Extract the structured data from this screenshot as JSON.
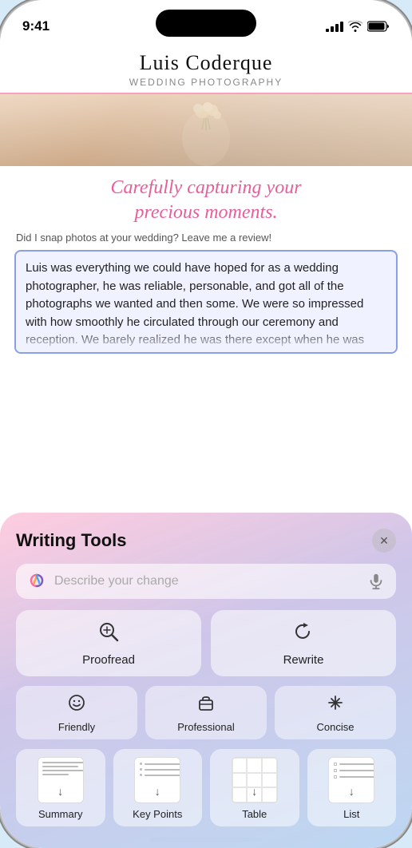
{
  "status_bar": {
    "time": "9:41",
    "signal_bars": 4,
    "wifi": true,
    "battery": "full"
  },
  "site": {
    "title": "Luis Coderque",
    "subtitle": "Wedding Photography",
    "tagline": "Carefully capturing your\nprecious moments.",
    "review_prompt": "Did I snap photos at your wedding? Leave me a review!",
    "review_text": "Luis was everything we could have hoped for as a wedding photographer, he was reliable, personable, and got all of the photographs we wanted and then some. We were so impressed with how smoothly he circulated through our ceremony and reception. We barely realized he was there except when he was very"
  },
  "writing_tools": {
    "title": "Writing Tools",
    "close_label": "✕",
    "search_placeholder": "Describe your change",
    "tools_large": [
      {
        "id": "proofread",
        "label": "Proofread",
        "icon": "🔍"
      },
      {
        "id": "rewrite",
        "label": "Rewrite",
        "icon": "↺"
      }
    ],
    "tools_medium": [
      {
        "id": "friendly",
        "label": "Friendly",
        "icon": "🙂"
      },
      {
        "id": "professional",
        "label": "Professional",
        "icon": "💼"
      },
      {
        "id": "concise",
        "label": "Concise",
        "icon": "✳"
      }
    ],
    "tools_small": [
      {
        "id": "summary",
        "label": "Summary"
      },
      {
        "id": "key-points",
        "label": "Key Points"
      },
      {
        "id": "table",
        "label": "Table"
      },
      {
        "id": "list",
        "label": "List"
      }
    ]
  }
}
